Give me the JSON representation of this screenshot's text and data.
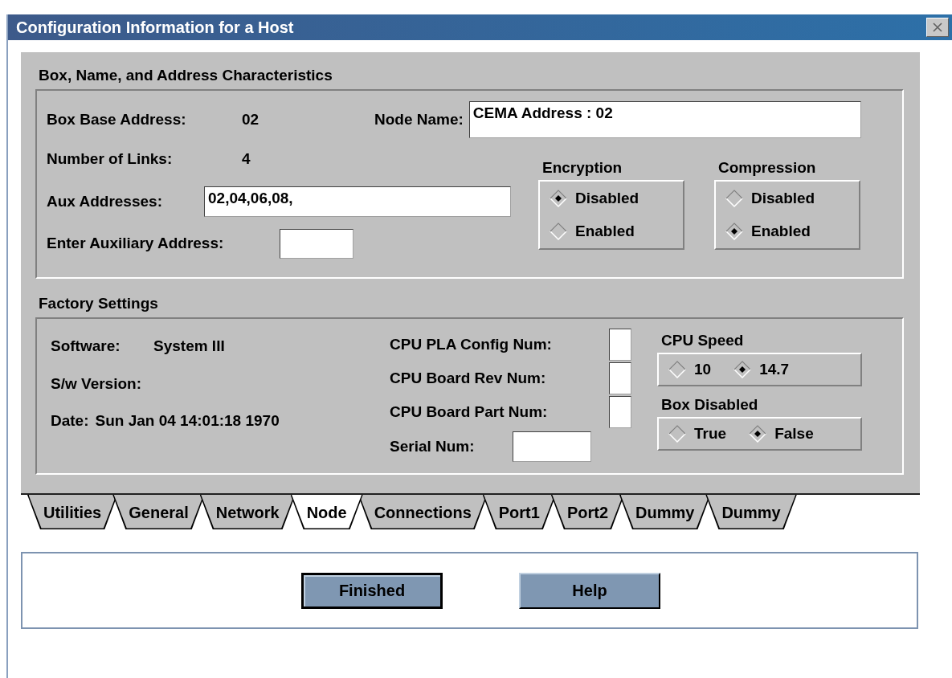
{
  "window": {
    "title": "Configuration Information for a Host"
  },
  "box_section": {
    "title": "Box, Name, and Address Characteristics",
    "box_base_address": {
      "label": "Box Base Address:",
      "value": "02"
    },
    "node_name": {
      "label": "Node Name:",
      "value": "CEMA Address : 02"
    },
    "number_of_links": {
      "label": "Number of Links:",
      "value": "4"
    },
    "aux_addresses": {
      "label": "Aux Addresses:",
      "value": "02,04,06,08,"
    },
    "enter_auxiliary_address": {
      "label": "Enter Auxiliary Address:"
    },
    "radio_groups": [
      {
        "title": "Encryption",
        "options": [
          {
            "label": "Disabled",
            "selected": true
          },
          {
            "label": "Enabled",
            "selected": false
          }
        ]
      },
      {
        "title": "Compression",
        "options": [
          {
            "label": "Disabled",
            "selected": false
          },
          {
            "label": "Enabled",
            "selected": true
          }
        ]
      }
    ]
  },
  "factory_section": {
    "title": "Factory Settings",
    "software": {
      "label": "Software:",
      "value": "System III"
    },
    "sw_version": {
      "label": "S/w Version:"
    },
    "date": {
      "label": "Date:",
      "value": "Sun Jan 04 14:01:18 1970"
    },
    "cpu_fields": [
      {
        "label": "CPU PLA Config Num:"
      },
      {
        "label": "CPU Board Rev Num:"
      },
      {
        "label": "CPU Board Part Num:"
      }
    ],
    "serial_num": {
      "label": "Serial Num:"
    },
    "radio_groups": [
      {
        "title": "CPU Speed",
        "options": [
          {
            "label": "10",
            "selected": false
          },
          {
            "label": "14.7",
            "selected": true
          }
        ]
      },
      {
        "title": "Box Disabled",
        "options": [
          {
            "label": "True",
            "selected": false
          },
          {
            "label": "False",
            "selected": true
          }
        ]
      }
    ]
  },
  "tabs": [
    {
      "label": "Utilities",
      "selected": false
    },
    {
      "label": "General",
      "selected": false
    },
    {
      "label": "Network",
      "selected": false
    },
    {
      "label": "Node",
      "selected": true
    },
    {
      "label": "Connections",
      "selected": false
    },
    {
      "label": "Port1",
      "selected": false
    },
    {
      "label": "Port2",
      "selected": false
    },
    {
      "label": "Dummy",
      "selected": false
    },
    {
      "label": "Dummy",
      "selected": false
    }
  ],
  "buttons": [
    {
      "label": "Finished",
      "default": true
    },
    {
      "label": "Help",
      "default": false
    }
  ]
}
